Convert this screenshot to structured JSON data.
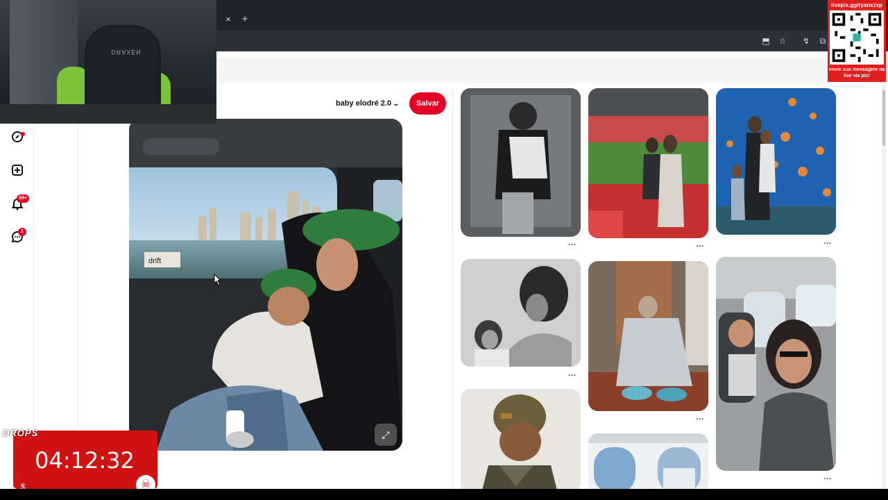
{
  "browser": {
    "tab_close": "×",
    "new_tab": "+",
    "toolbar_icons": [
      "install-app-icon",
      "star-icon",
      "extension-icon",
      "puzzle-icon"
    ]
  },
  "overlay": {
    "qr_top_text": "livepix.gg/ryanxzxp",
    "qr_bottom_text": "envie sua mensagem na live via pix!",
    "timer_tag": "DROPS",
    "timer_value": "04:12:32",
    "chair_brand": "DRAXEN"
  },
  "sidebar": {
    "items": [
      {
        "icon": "compass-icon",
        "glyph": "◎",
        "badge": ""
      },
      {
        "icon": "create-icon",
        "glyph": "⊞",
        "badge": ""
      },
      {
        "icon": "bell-icon",
        "glyph": "🔔",
        "badge": "99+"
      },
      {
        "icon": "message-icon",
        "glyph": "💬",
        "badge": "1"
      }
    ]
  },
  "pin": {
    "board_name": "baby elodré 2.0",
    "save_label": "Salvar",
    "image_text": "drift",
    "expand_icon": "⤢"
  },
  "grid": {
    "more_glyph": "···"
  },
  "colors": {
    "accent": "#e60023",
    "overlay_red": "#d11212",
    "chrome": "#1f2428"
  }
}
